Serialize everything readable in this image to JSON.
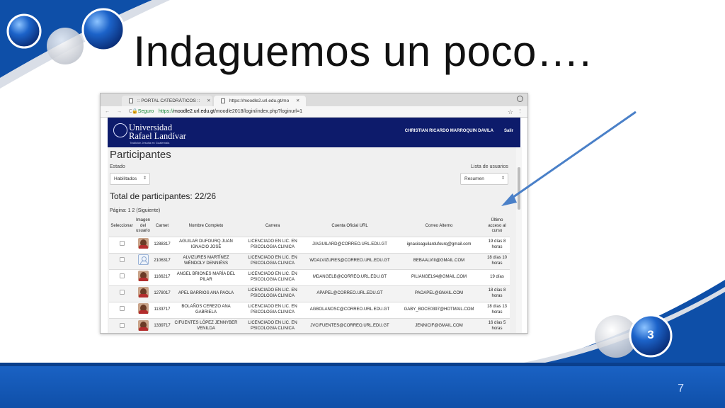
{
  "slide": {
    "title": "Indaguemos un poco….",
    "page_number": "7",
    "ball_number": "3",
    "accent_color": "#1a62c4"
  },
  "browser": {
    "tabs": [
      {
        "label": ":: PORTAL CATEDRÁTICOS ::"
      },
      {
        "label": "https://moodle2.url.edu.gt/mo"
      }
    ],
    "address": {
      "secure_label": "Seguro",
      "url_prefix": "https://",
      "url_host": "moodle2.url.edu.gt",
      "url_path": "/moodle2018/login/index.php?loginurl=1"
    }
  },
  "site": {
    "logo_line1": "Universidad",
    "logo_line2": "Rafael Landívar",
    "logo_sub": "Tradición Jesuita en Guatemala",
    "user_name": "CHRISTIAN RICARDO MARROQUIN DAVILA",
    "logout_label": "Salir"
  },
  "page": {
    "heading": "Participantes",
    "estado_label": "Estado",
    "estado_value": "Habilitados",
    "lista_label": "Lista de usuarios",
    "lista_value": "Resumen",
    "total": "Total de participantes: 22/26",
    "pagination": "Página: 1 2 (Siguiente)"
  },
  "table": {
    "headers": {
      "select": "Seleccionar",
      "image": "Imagen del usuario",
      "carnet": "Carnet",
      "name": "Nombre Completo",
      "career": "Carrera",
      "email": "Cuenta Oficial URL",
      "alt_email": "Correo Alterno",
      "last_access": "Último acceso al curso"
    },
    "rows": [
      {
        "carnet": "1288317",
        "name": "AGUILAR DUFOURQ JUAN IGNACIO JOSÉ",
        "career": "LICENCIADO EN LIC. EN PSICOLOGIA CLINICA",
        "email": "JIAGUILARD@CORREO.URL.EDU.GT",
        "alt": "ignacioaguilardufourq@gmail.com",
        "last": "19 días 8 horas",
        "avatar": "photo"
      },
      {
        "carnet": "2106317",
        "name": "ALVIZURES MARTÍNEZ WÉNDOLY DENNIÉSS",
        "career": "LICENCIADO EN LIC. EN PSICOLOGIA CLINICA",
        "email": "WDALVIZURES@CORREO.URL.EDU.GT",
        "alt": "BEBAALVIII@GMAIL.COM",
        "last": "18 días 10 horas",
        "avatar": "blank"
      },
      {
        "carnet": "1166217",
        "name": "ANGEL BRIONES MARÍA DEL PILAR",
        "career": "LICENCIADO EN LIC. EN PSICOLOGIA CLINICA",
        "email": "MDANGELB@CORREO.URL.EDU.GT",
        "alt": "PILIANGEL94@GMAIL.COM",
        "last": "19 días",
        "avatar": "photo"
      },
      {
        "carnet": "1278017",
        "name": "APEL BARRIOS ANA PAOLA",
        "career": "LICENCIADO EN LIC. EN PSICOLOGIA CLINICA",
        "email": "APAPEL@CORREO.URL.EDU.GT",
        "alt": "PAOAPEL@GMAIL.COM",
        "last": "18 días 8 horas",
        "avatar": "photo"
      },
      {
        "carnet": "1133717",
        "name": "BOLAÑOS CEREZO ANA GABRIELA",
        "career": "LICENCIADO EN LIC. EN PSICOLOGIA CLINICA",
        "email": "AGBOLANOSC@CORREO.URL.EDU.GT",
        "alt": "GABY_BOCE0397@HOTMAIL.COM",
        "last": "18 días 13 horas",
        "avatar": "photo"
      },
      {
        "carnet": "1339717",
        "name": "CIFUENTES LÓPEZ JENNYBER VENILDA",
        "career": "LICENCIADO EN LIC. EN PSICOLOGIA CLINICA",
        "email": "JVCIFUENTES@CORREO.URL.EDU.GT",
        "alt": "JENNICIF@GMAIL.COM",
        "last": "16 días 5 horas",
        "avatar": "photo"
      }
    ]
  }
}
